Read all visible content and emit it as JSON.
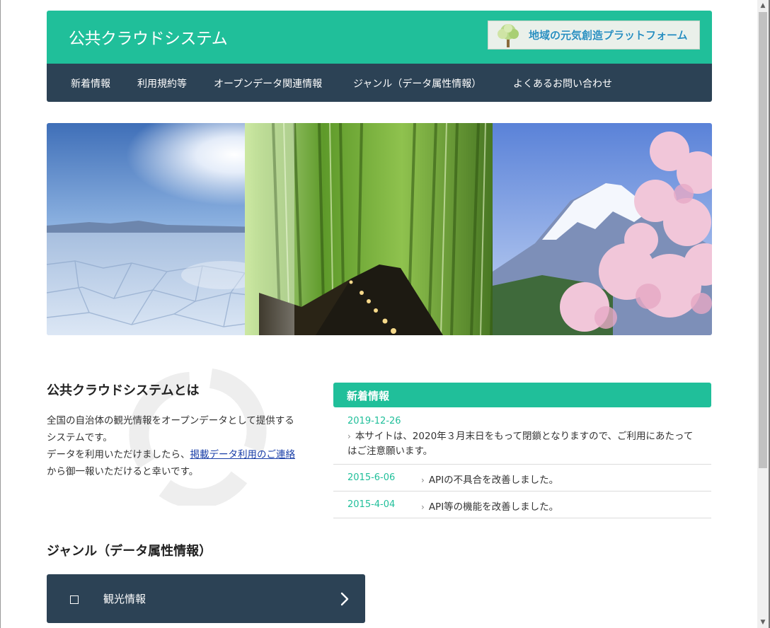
{
  "header": {
    "site_title": "公共クラウドシステム",
    "banner_text": "地域の元気創造プラットフォーム"
  },
  "nav": {
    "items": [
      {
        "label": "新着情報"
      },
      {
        "label": "利用規約等"
      },
      {
        "label": "オープンデータ関連情報"
      },
      {
        "label": "ジャンル（データ属性情報）"
      },
      {
        "label": "よくあるお問い合わせ"
      }
    ]
  },
  "about": {
    "title": "公共クラウドシステムとは",
    "text_1": "全国の自治体の観光情報をオープンデータとして提供するシステムです。",
    "text_2": "データを利用いただけましたら、",
    "link": "掲載データ利用のご連絡",
    "text_3": "から御一報いただけると幸いです。"
  },
  "news": {
    "heading": "新着情報",
    "items": [
      {
        "date": "2019-12-26",
        "text": "本サイトは、2020年３月末日をもって閉鎖となりますので、ご利用にあたってはご注意願います。"
      },
      {
        "date": "2015-6-06",
        "text": "APIの不具合を改善しました。"
      },
      {
        "date": "2015-4-04",
        "text": "API等の機能を改善しました。"
      }
    ]
  },
  "genre": {
    "title": "ジャンル（データ属性情報）",
    "card_label": "観光情報"
  },
  "colors": {
    "accent": "#20bf9a",
    "navy": "#2c4255"
  }
}
